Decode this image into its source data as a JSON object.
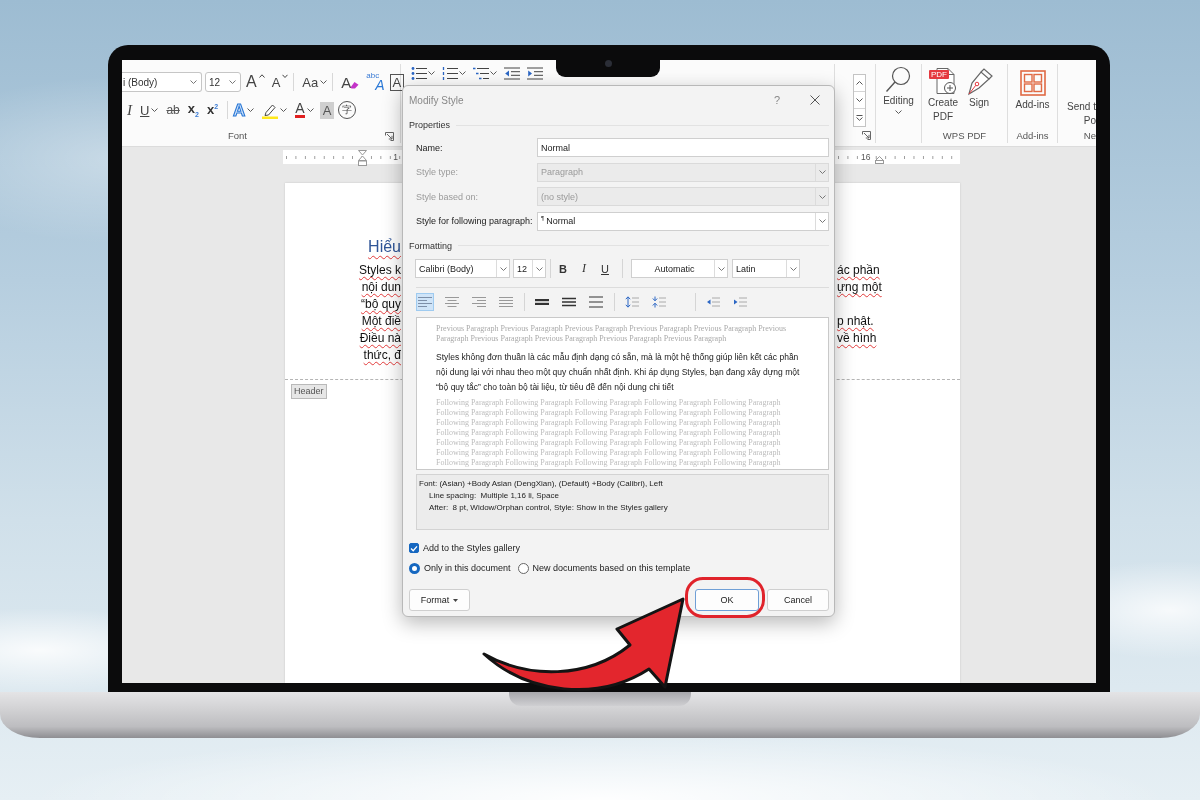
{
  "ribbon": {
    "font_group": {
      "font_name": "i (Body)",
      "font_size": "12",
      "row_1": [
        {
          "kind": "grow",
          "glyph": "A",
          "dropdown": false
        },
        {
          "kind": "shrink",
          "glyph": "A",
          "dropdown": false
        },
        {
          "kind": "case",
          "glyph": "Aa",
          "dropdown": true
        },
        {
          "kind": "clear",
          "glyph": "A",
          "dropdown": false
        },
        {
          "kind": "phonetic",
          "note": "abc",
          "glyph": "A",
          "dropdown": false
        },
        {
          "kind": "border",
          "glyph": "A",
          "dropdown": false
        }
      ],
      "row_2": [
        {
          "kind": "italic",
          "glyph": "I",
          "dropdown": false
        },
        {
          "kind": "underline",
          "glyph": "U",
          "dropdown": true
        },
        {
          "kind": "strike",
          "glyph": "ab",
          "dropdown": false
        },
        {
          "kind": "subscript",
          "glyph": "x$_{2}$",
          "dropdown": false
        },
        {
          "kind": "superscript",
          "glyph": "x$^{2}$",
          "dropdown": false
        },
        {
          "kind": "effects",
          "glyph": "A",
          "dropdown": true
        },
        {
          "kind": "highlight",
          "dropdown": true
        },
        {
          "kind": "color",
          "glyph": "A",
          "dropdown": true
        },
        {
          "kind": "shading",
          "glyph": "A",
          "dropdown": false
        },
        {
          "kind": "enclose",
          "glyph": "字",
          "dropdown": false
        }
      ],
      "label": "Font"
    },
    "paragraph_group": {
      "row_1": [
        {
          "kind": "bullets",
          "dropdown": true
        },
        {
          "kind": "numbering",
          "dropdown": true
        },
        {
          "kind": "multilevel",
          "dropdown": true
        },
        {
          "kind": "outdent",
          "dropdown": false
        },
        {
          "kind": "indent",
          "dropdown": false
        }
      ]
    },
    "editing": {
      "label": "Editing"
    },
    "wps_pdf": {
      "buttons": [
        {
          "kind": "create_pdf",
          "badge": "PDF",
          "label_lines": [
            "Create",
            "PDF"
          ]
        },
        {
          "kind": "sign",
          "label_lines": [
            "Sign"
          ]
        }
      ],
      "label": "WPS PDF"
    },
    "add_ins": {
      "button_lines": [
        "Add-ins"
      ],
      "label": "Add-ins"
    },
    "cut_group": {
      "button_lines": [
        "Send t",
        "Po"
      ],
      "label": "Ne"
    }
  },
  "ruler": {
    "left_number": "1",
    "right_number": "16"
  },
  "document": {
    "heading": "Hiểu",
    "lines": [
      {
        "left": "Styles k",
        "right": "ác phần"
      },
      {
        "left": "nội dun",
        "right": "ựng một"
      },
      {
        "left": "“bộ quy"
      },
      {
        "left": "Một điề",
        "right": "p nhật."
      },
      {
        "left": "Điều nà",
        "right": "về hình"
      },
      {
        "left": "thức, đ"
      }
    ],
    "header_tag": "Header"
  },
  "dialog": {
    "title": "Modify Style",
    "help": "?",
    "properties": {
      "heading": "Properties",
      "fields": [
        {
          "kind": "text",
          "label": "Name:",
          "value": "Normal",
          "disabled": false
        },
        {
          "kind": "select",
          "label": "Style type:",
          "value": "Paragraph",
          "disabled": true
        },
        {
          "kind": "select",
          "label": "Style based on:",
          "value": "(no style)",
          "disabled": true
        },
        {
          "kind": "select",
          "label": "Style for following paragraph:",
          "style_mark": "¶",
          "value": "Normal",
          "disabled": false
        }
      ]
    },
    "formatting": {
      "heading": "Formatting",
      "font": "Calibri (Body)",
      "size": "12",
      "styles": [
        {
          "kind": "bold",
          "glyph": "B"
        },
        {
          "kind": "italic",
          "glyph": "I"
        },
        {
          "kind": "underline",
          "glyph": "U"
        }
      ],
      "palette_value": "Automatic",
      "script": "Latin",
      "alignment": [
        {
          "kind": "left",
          "selected": true
        },
        {
          "kind": "center",
          "selected": false
        },
        {
          "kind": "right",
          "selected": false
        },
        {
          "kind": "justify",
          "selected": false
        }
      ],
      "line_spacing": [
        {
          "kind": "single"
        },
        {
          "kind": "one_half"
        },
        {
          "kind": "double"
        }
      ],
      "paragraph_spacing": [
        {
          "kind": "increase"
        },
        {
          "kind": "decrease"
        }
      ],
      "indent": [
        {
          "kind": "decrease"
        },
        {
          "kind": "increase"
        }
      ]
    },
    "preview": {
      "previous": "Previous Paragraph Previous Paragraph Previous Paragraph Previous Paragraph Previous Paragraph Previous Paragraph Previous Paragraph Previous Paragraph Previous Paragraph Previous Paragraph",
      "sample": "Styles không đơn thuần là các mẫu định dạng có sẵn, mà là một hệ thống giúp liên kết các phần nội dung lại với nhau theo một quy chuẩn nhất định. Khi áp dụng Styles, bạn đang xây dựng một “bộ quy tắc” cho toàn bộ tài liệu, từ tiêu đề đến nội dung chi tiết",
      "following": "Following Paragraph Following Paragraph Following Paragraph Following Paragraph Following Paragraph Following Paragraph Following Paragraph Following Paragraph Following Paragraph Following Paragraph Following Paragraph Following Paragraph Following Paragraph Following Paragraph Following Paragraph Following Paragraph Following Paragraph Following Paragraph Following Paragraph Following Paragraph Following Paragraph Following Paragraph Following Paragraph Following Paragraph Following Paragraph Following Paragraph Following Paragraph Following Paragraph Following Paragraph Following Paragraph Following Paragraph Following Paragraph Following Paragraph Following Paragraph Following Paragraph"
    },
    "description": [
      "Font: (Asian) +Body Asian (DengXian), (Default) +Body (Calibri), Left",
      "Line spacing:  Multiple 1,16 li, Space",
      "After:  8 pt, Widow/Orphan control, Style: Show in the Styles gallery"
    ],
    "add_to_gallery": {
      "label": "Add to the Styles gallery",
      "checked": true
    },
    "scope": [
      {
        "label": "Only in this document",
        "selected": true
      },
      {
        "label": "New documents based on this template",
        "selected": false
      }
    ],
    "buttons": [
      {
        "kind": "menu",
        "label": "Format",
        "highlighted": false
      },
      {
        "kind": "default",
        "label": "OK",
        "highlighted": true
      },
      {
        "kind": "plain",
        "label": "Cancel",
        "highlighted": false
      }
    ]
  }
}
